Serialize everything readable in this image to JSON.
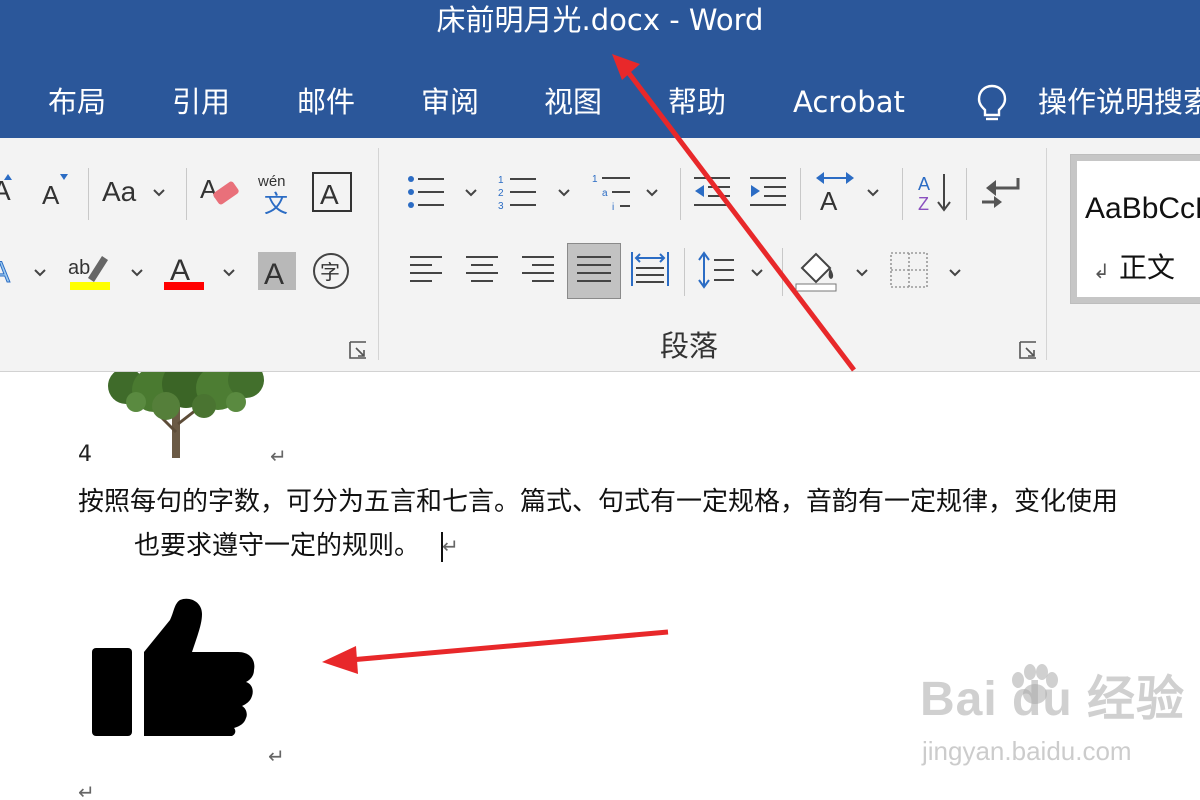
{
  "window": {
    "title": "床前明月光.docx  -  Word"
  },
  "tabs": [
    {
      "label": "布局"
    },
    {
      "label": "引用"
    },
    {
      "label": "邮件"
    },
    {
      "label": "审阅"
    },
    {
      "label": "视图"
    },
    {
      "label": "帮助"
    },
    {
      "label": "Acrobat"
    }
  ],
  "tell_me": {
    "label": "操作说明搜索",
    "icon": "lightbulb-icon"
  },
  "ribbon": {
    "font_group": {
      "change_case": "Aa",
      "font_color_letter": "A",
      "highlight_color": "#ffff00",
      "font_color": "#ff0000",
      "phonetic_top": "wén",
      "phonetic_char": "文",
      "char_border": "A",
      "char_shading": "A",
      "enclose_char": "字",
      "highlight_letters": "ab"
    },
    "paragraph_group": {
      "label": "段落"
    },
    "styles_group": {
      "sample": "AaBbCcDd",
      "style_name": "正文",
      "style_mark": "↲"
    }
  },
  "document": {
    "number_line": "4",
    "paragraph_line1": "按照每句的字数，可分为五言和七言。篇式、句式有一定规格，音韵有一定规律，变化使用",
    "paragraph_line2": "也要求遵守一定的规则。",
    "para_mark": "↵"
  },
  "watermark": {
    "logo": "Bai  du 经验",
    "url": "jingyan.baidu.com"
  },
  "colors": {
    "title_bar": "#2b579a",
    "ribbon_bg": "#f3f3f3",
    "annotation_arrow": "#e8282a"
  }
}
